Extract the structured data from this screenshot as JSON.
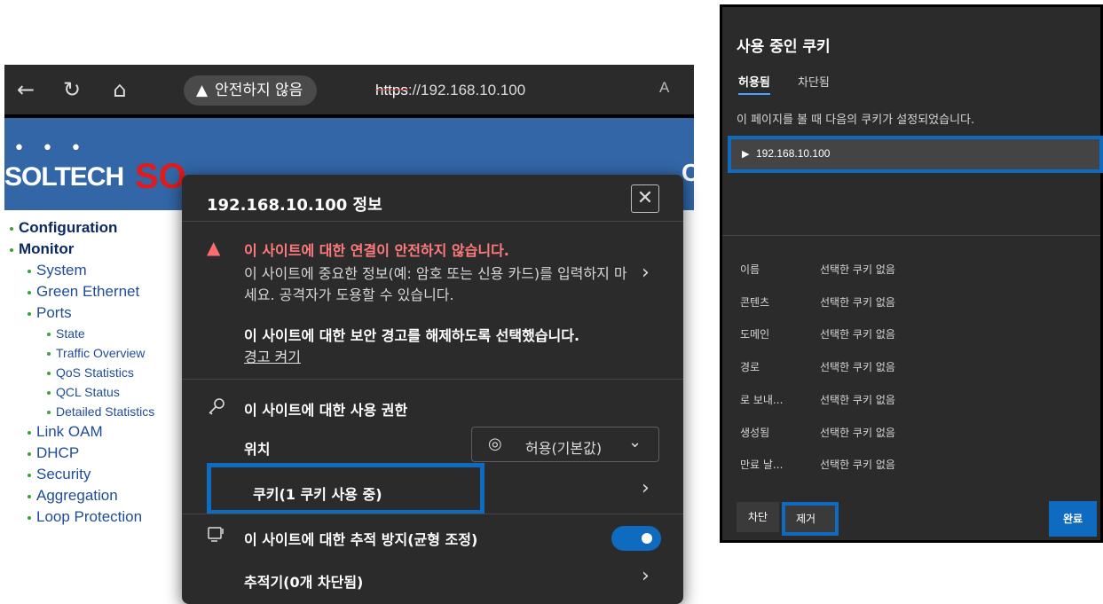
{
  "browser": {
    "toolbar": {
      "back_icon": "←",
      "reload_icon": "↻",
      "home_icon": "⌂",
      "security_warn_icon": "▲",
      "security_label": "안전하지 않음",
      "url_scheme": "https",
      "url_rest": "://192.168.10.100",
      "read_aloud_icon": "A"
    },
    "page": {
      "logo_dots": "• • •",
      "logo_text": "SOLTECH",
      "logo_red": "SO",
      "logo_right": "C",
      "nav": [
        {
          "label": "Configuration",
          "level": 0
        },
        {
          "label": "Monitor",
          "level": 0
        },
        {
          "label": "System",
          "level": 1
        },
        {
          "label": "Green Ethernet",
          "level": 1
        },
        {
          "label": "Ports",
          "level": 1
        },
        {
          "label": "State",
          "level": 2
        },
        {
          "label": "Traffic Overview",
          "level": 2
        },
        {
          "label": "QoS Statistics",
          "level": 2
        },
        {
          "label": "QCL Status",
          "level": 2
        },
        {
          "label": "Detailed Statistics",
          "level": 2
        },
        {
          "label": "Link OAM",
          "level": 1
        },
        {
          "label": "DHCP",
          "level": 1
        },
        {
          "label": "Security",
          "level": 1
        },
        {
          "label": "Aggregation",
          "level": 1
        },
        {
          "label": "Loop Protection",
          "level": 1
        }
      ]
    },
    "popup": {
      "title": "192.168.10.100 정보",
      "close_icon": "✕",
      "warning_icon": "▲",
      "warning_title": "이 사이트에 대한 연결이 안전하지 않습니다.",
      "warning_body": "이 사이트에 중요한 정보(예: 암호 또는 신용 카드)를 입력하지 마세요. 공격자가 도용할 수 있습니다.",
      "chevron": "›",
      "bypass_text": "이 사이트에 대한 보안 경고를 해제하도록 선택했습니다.",
      "bypass_link": "경고 켜기",
      "permissions_icon": "key-icon",
      "permissions_title": "이 사이트에 대한 사용 권한",
      "location_label": "위치",
      "location_value": "허용(기본값)",
      "location_pin": "◎",
      "location_chevron": "⌄",
      "cookie_label": "쿠키(1 쿠키 사용 중)",
      "tracking_title": "이 사이트에 대한 추적 방지(균형 조정)",
      "tracking_enabled": true,
      "trackers_label": "추적기(0개 차단됨)"
    }
  },
  "cookies_panel": {
    "title": "사용 중인 쿠키",
    "tab_allowed": "허용됨",
    "tab_blocked": "차단됨",
    "description": "이 페이지를 볼 때 다음의 쿠키가 설정되었습니다.",
    "site_triangle": "▶",
    "site": "192.168.10.100",
    "properties": [
      {
        "name": "이름",
        "value": "선택한 쿠키 없음"
      },
      {
        "name": "콘텐츠",
        "value": "선택한 쿠키 없음"
      },
      {
        "name": "도메인",
        "value": "선택한 쿠키 없음"
      },
      {
        "name": "경로",
        "value": "선택한 쿠키 없음"
      },
      {
        "name": "로 보내...",
        "value": "선택한 쿠키 없음"
      },
      {
        "name": "생성됨",
        "value": "선택한 쿠키 없음"
      },
      {
        "name": "만료 날...",
        "value": "선택한 쿠키 없음"
      }
    ],
    "block_button": "차단",
    "remove_button": "제거",
    "done_button": "완료"
  }
}
